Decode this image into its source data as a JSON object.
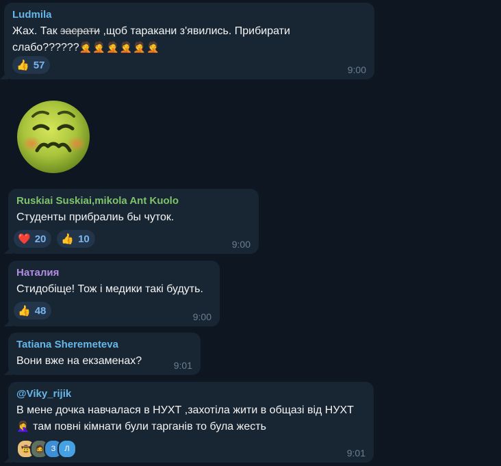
{
  "colors": {
    "background": "#0e1621",
    "bubble": "#182533",
    "reaction_pill": "#22354a",
    "reaction_text": "#7ab7ef",
    "time": "#6d7f8f"
  },
  "messages": [
    {
      "author": "Ludmila",
      "author_color": "#67b7e8",
      "text_line1_pre": "Жах. Так ",
      "text_line1_strike": "засрати",
      "text_line1_post": " ,щоб таракани з'явились. Прибирати",
      "text_line2": "слабо??????",
      "text_line2_emojis": "🤦🤦🤦🤦🤦🤦",
      "reactions": [
        {
          "emoji": "👍",
          "count": "57"
        }
      ],
      "time": "9:00"
    },
    {
      "sticker": "nauseated-face-sticker"
    },
    {
      "author": "Ruskiai Suskiai,mikola Ant Kuolo",
      "author_color": "#7fc46c",
      "text": "Студенты прибралиь бы чуток.",
      "reactions": [
        {
          "emoji": "❤️",
          "count": "20"
        },
        {
          "emoji": "👍",
          "count": "10"
        }
      ],
      "time": "9:00"
    },
    {
      "author": "Наталия",
      "author_color": "#b18de3",
      "text": "Стидобіще! Тож і медики такі будуть.",
      "reactions": [
        {
          "emoji": "👍",
          "count": "48"
        }
      ],
      "time": "9:00"
    },
    {
      "author": "Tatiana Sheremeteva",
      "author_color": "#67b7e8",
      "text": "Вони вже на екзаменах?",
      "time": "9:01"
    },
    {
      "author": "@Viky_rijik",
      "author_color": "#67b7e8",
      "text_line1": "В мене дочка навчалася в НУХТ ,захотіла жити в общазі від НУХТ",
      "text_line2_emoji": "🤦‍♀️",
      "text_line2": " там повні кімнати були тарганів то була жесть",
      "reactor_avatars": [
        {
          "emoji": "🤠",
          "color": "#e8c07a"
        },
        {
          "emoji": "🧔",
          "color": "#607060"
        },
        {
          "letter": "З",
          "color": "#3f8fd6"
        },
        {
          "letter": "Л",
          "color": "#46a1e3"
        }
      ],
      "time": "9:01"
    }
  ]
}
